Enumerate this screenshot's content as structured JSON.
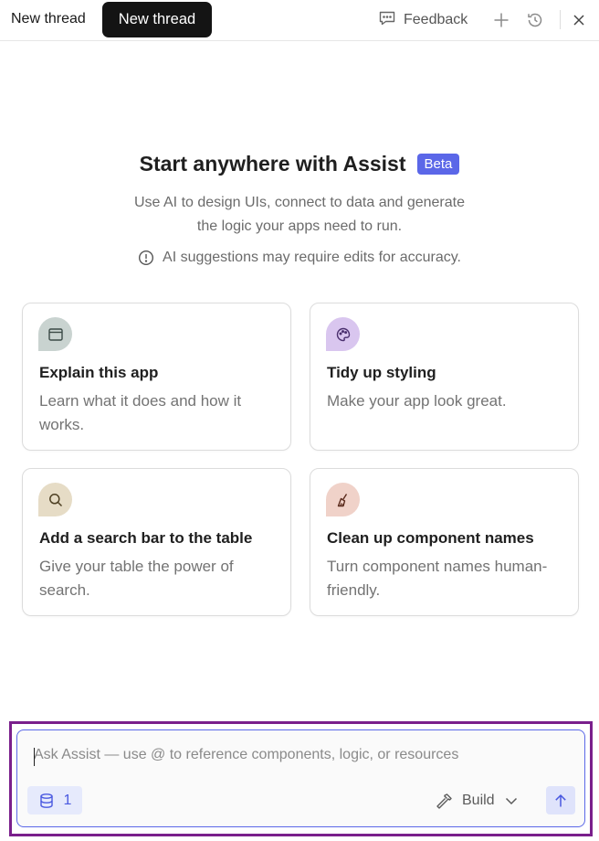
{
  "header": {
    "title": "New thread",
    "tooltip": "New thread",
    "feedback_label": "Feedback"
  },
  "hero": {
    "title": "Start anywhere with Assist",
    "badge": "Beta",
    "description_line1": "Use AI to design UIs, connect to data and generate",
    "description_line2": "the logic your apps need to run.",
    "warning": "AI suggestions may require edits for accuracy."
  },
  "cards": [
    {
      "title": "Explain this app",
      "description": "Learn what it does and how it works.",
      "icon": "app-window-icon",
      "icon_bg": "#c9d3d0"
    },
    {
      "title": "Tidy up styling",
      "description": "Make your app look great.",
      "icon": "palette-icon",
      "icon_bg": "#d9c6ef"
    },
    {
      "title": "Add a search bar to the table",
      "description": "Give your table the power of search.",
      "icon": "search-icon",
      "icon_bg": "#e6dcc6"
    },
    {
      "title": "Clean up component names",
      "description": "Turn component names human-friendly.",
      "icon": "broom-icon",
      "icon_bg": "#f0d2c9"
    }
  ],
  "composer": {
    "placeholder": "Ask Assist — use @ to reference components, logic, or resources",
    "value": "",
    "resource_count": "1",
    "mode_label": "Build"
  },
  "colors": {
    "accent": "#5b67e8",
    "outline": "#7a1f8c",
    "tooltip_bg": "#141414"
  }
}
